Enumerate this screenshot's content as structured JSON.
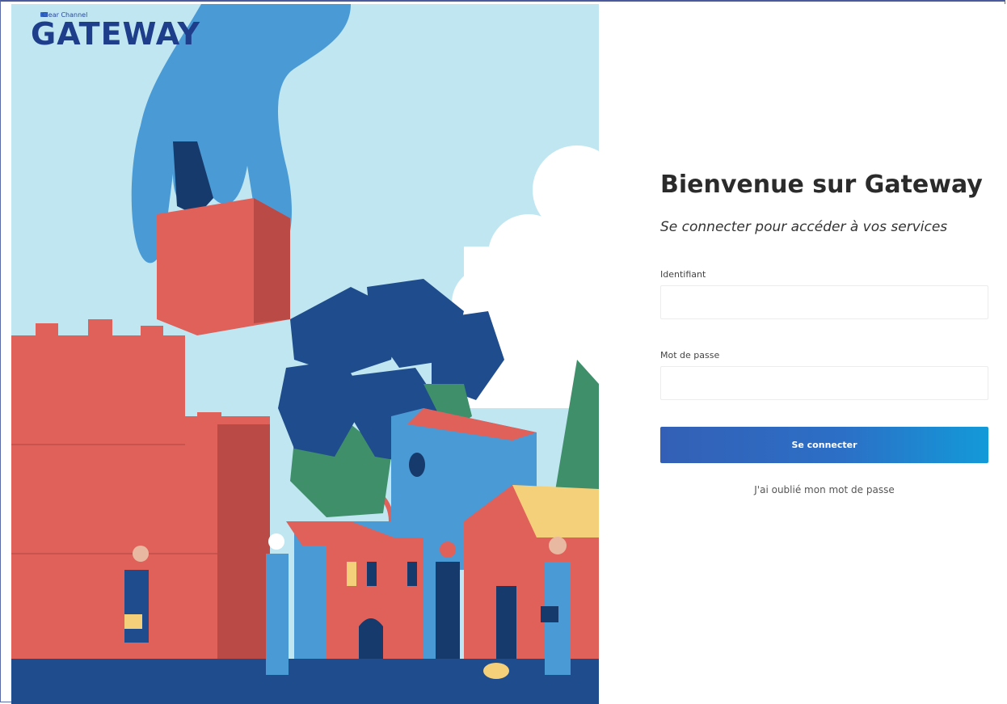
{
  "logo": {
    "small": "Clear Channel",
    "big": "GATEWAY"
  },
  "login": {
    "title": "Bienvenue sur Gateway",
    "subtitle": "Se connecter pour accéder à vos services",
    "username_label": "Identifiant",
    "username_value": "",
    "password_label": "Mot de passe",
    "password_value": "",
    "submit_label": "Se connecter",
    "forgot_label": "J'ai oublié mon mot de passe"
  },
  "colors": {
    "brand_blue": "#1e3e8c",
    "button_start": "#3360b6",
    "button_end": "#139ad8",
    "sky": "#bfe6f1",
    "brick": "#e0605a"
  }
}
